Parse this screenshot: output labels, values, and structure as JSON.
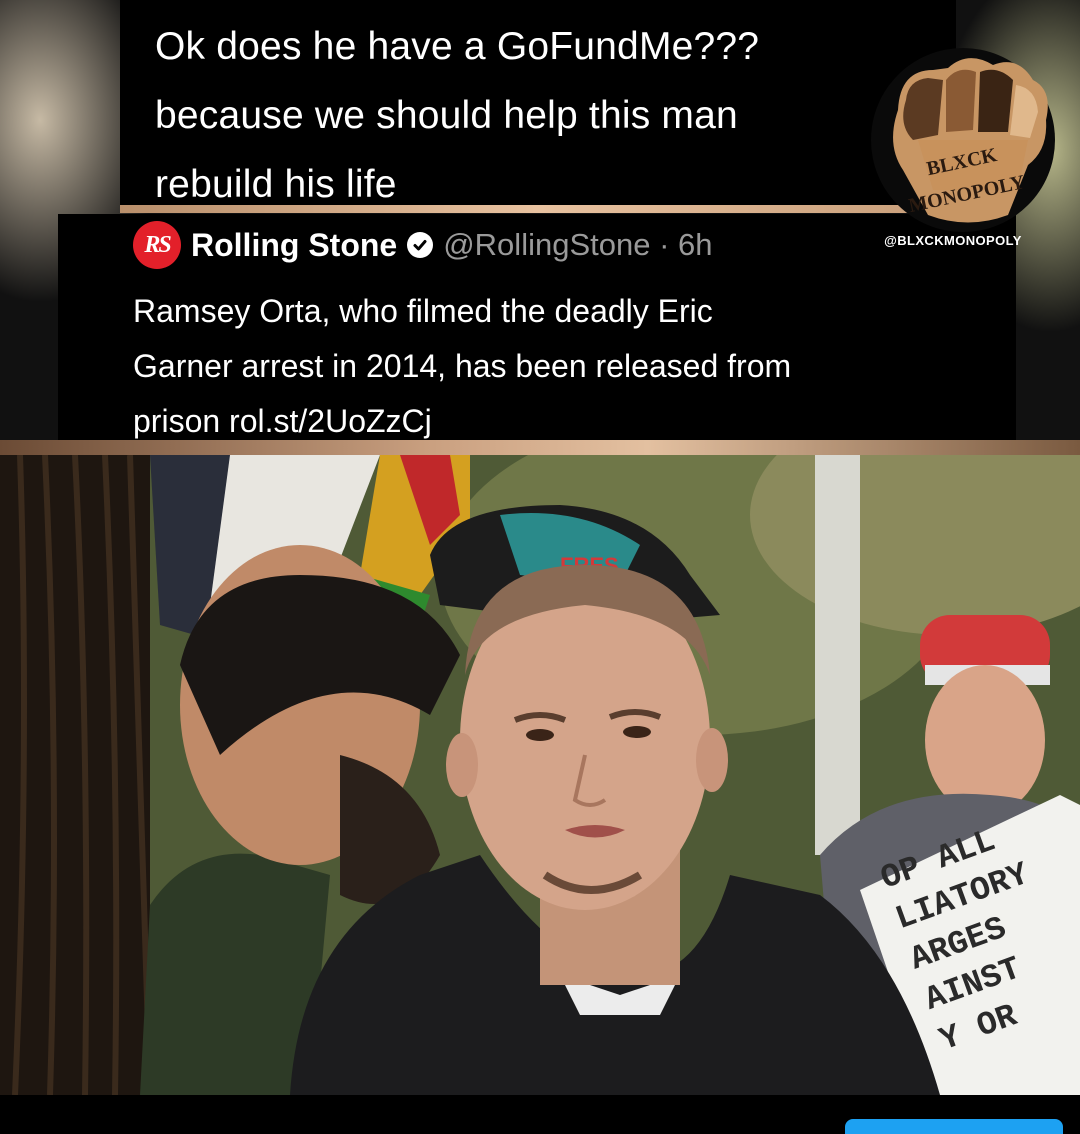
{
  "quote": {
    "text": "Ok does he have a GoFundMe???\nbecause we should help this man\nrebuild his life"
  },
  "tweet": {
    "logo_text": "RS",
    "name": "Rolling Stone",
    "handle": "@RollingStone · 6h",
    "body": "Ramsey Orta, who filmed the deadly Eric\nGarner arrest in 2014, has been released from\nprison rol.st/2UoZzCj"
  },
  "brand": {
    "logo_word_top": "BLXCK",
    "logo_word_bottom": "MONOPOLY",
    "handle": "@BLXCKMONOPOLY"
  },
  "photo": {
    "sign_text": "OP ALL\nLIATORY\nARGES\nAINST\nY OR",
    "cap_text": "FRES"
  },
  "colors": {
    "background": "#000000",
    "text": "#ffffff",
    "handle_gray": "#9a9a9a",
    "rs_red": "#e3202a",
    "accent_blue": "#1da1f2"
  }
}
